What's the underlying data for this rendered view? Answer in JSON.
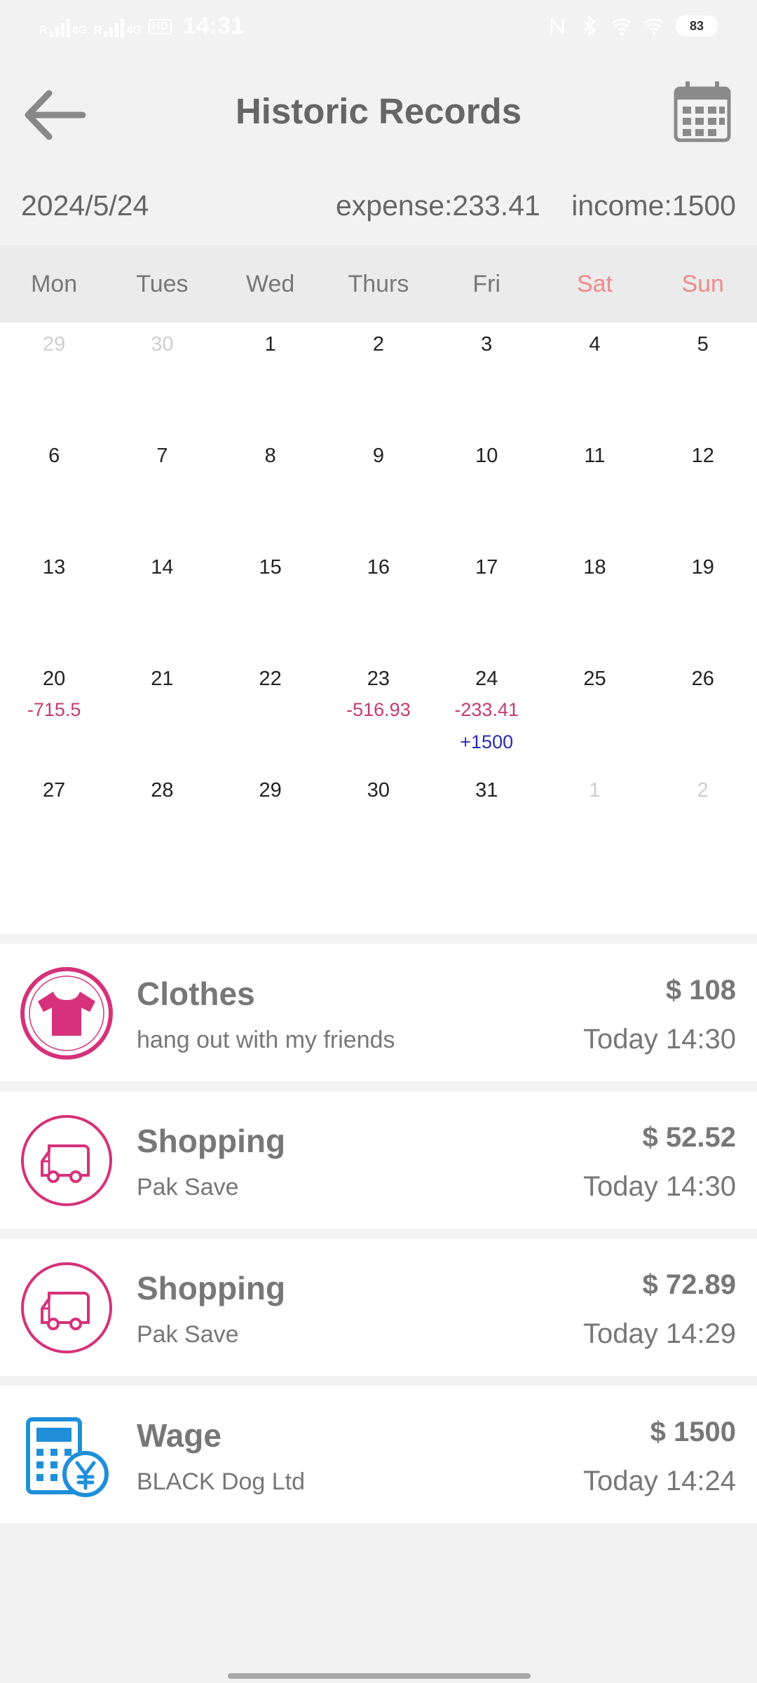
{
  "status_bar": {
    "time": "14:31",
    "signal1_label": "4G",
    "signal2_label": "4G",
    "roaming": "R",
    "hd_label": "HD",
    "battery": "83"
  },
  "header": {
    "title": "Historic Records",
    "back_icon": "arrow-left-icon",
    "calendar_icon": "calendar-icon"
  },
  "summary": {
    "date": "2024/5/24",
    "expense": "expense:233.41",
    "income": "income:1500"
  },
  "weekdays": [
    "Mon",
    "Tues",
    "Wed",
    "Thurs",
    "Fri",
    "Sat",
    "Sun"
  ],
  "colors": {
    "weekend": "#f08a8a",
    "expense": "#c43c72",
    "income": "#2b2bb0",
    "accent_pink": "#d6317a",
    "accent_blue": "#1e8fd8"
  },
  "calendar": {
    "weeks": [
      [
        {
          "day": "29",
          "faded": true
        },
        {
          "day": "30",
          "faded": true
        },
        {
          "day": "1"
        },
        {
          "day": "2"
        },
        {
          "day": "3"
        },
        {
          "day": "4"
        },
        {
          "day": "5"
        }
      ],
      [
        {
          "day": "6"
        },
        {
          "day": "7"
        },
        {
          "day": "8"
        },
        {
          "day": "9"
        },
        {
          "day": "10"
        },
        {
          "day": "11"
        },
        {
          "day": "12"
        }
      ],
      [
        {
          "day": "13"
        },
        {
          "day": "14"
        },
        {
          "day": "15"
        },
        {
          "day": "16"
        },
        {
          "day": "17"
        },
        {
          "day": "18"
        },
        {
          "day": "19"
        }
      ],
      [
        {
          "day": "20",
          "expense": "-715.5"
        },
        {
          "day": "21"
        },
        {
          "day": "22"
        },
        {
          "day": "23",
          "expense": "-516.93"
        },
        {
          "day": "24",
          "expense": "-233.41",
          "income": "+1500"
        },
        {
          "day": "25"
        },
        {
          "day": "26"
        }
      ],
      [
        {
          "day": "27"
        },
        {
          "day": "28"
        },
        {
          "day": "29"
        },
        {
          "day": "30"
        },
        {
          "day": "31"
        },
        {
          "day": "1",
          "faded": true
        },
        {
          "day": "2",
          "faded": true
        }
      ]
    ]
  },
  "records": [
    {
      "title": "Clothes",
      "note": "hang out with my friends",
      "amount": "$ 108",
      "time": "Today 14:30",
      "icon": "tshirt-icon"
    },
    {
      "title": "Shopping",
      "note": "Pak Save",
      "amount": "$ 52.52",
      "time": "Today 14:30",
      "icon": "truck-icon"
    },
    {
      "title": "Shopping",
      "note": "Pak Save",
      "amount": "$ 72.89",
      "time": "Today 14:29",
      "icon": "truck-icon"
    },
    {
      "title": "Wage",
      "note": "BLACK Dog Ltd",
      "amount": "$ 1500",
      "time": "Today 14:24",
      "icon": "calculator-yen-icon"
    }
  ]
}
